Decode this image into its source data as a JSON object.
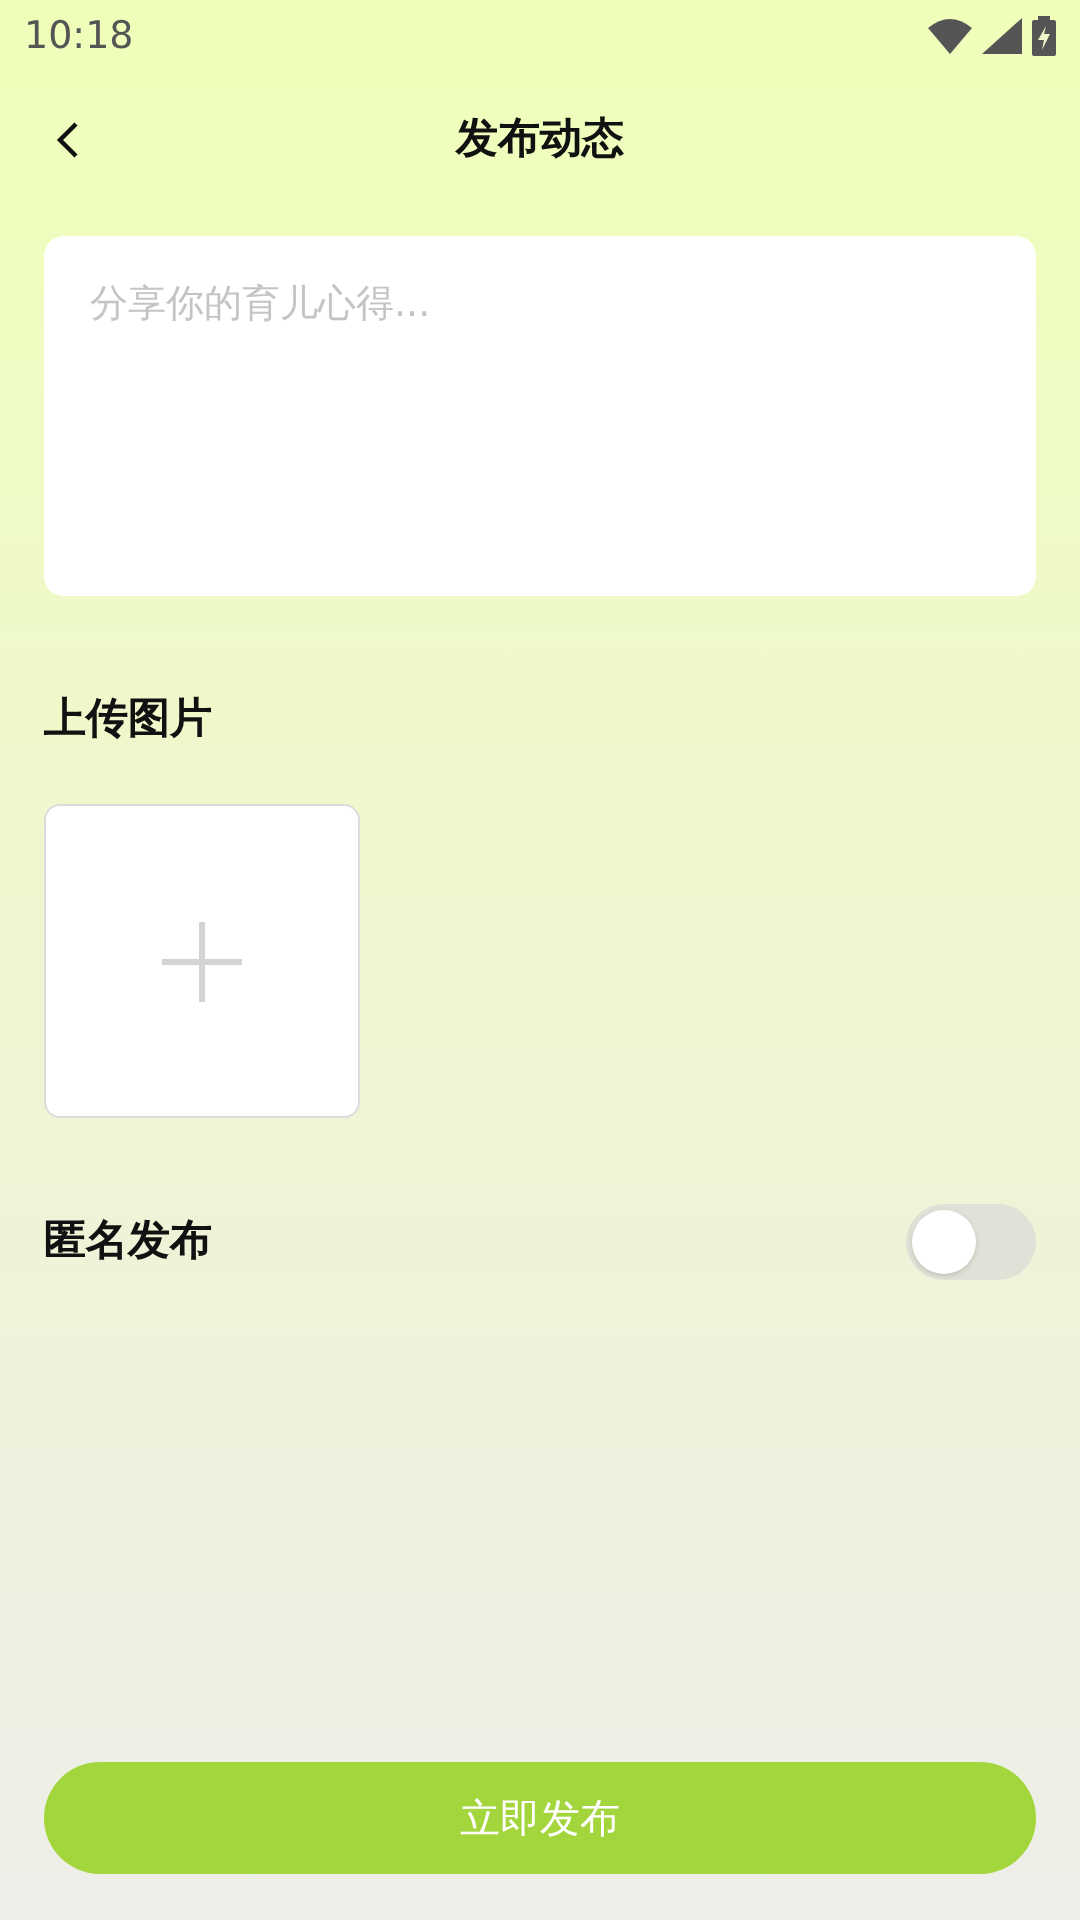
{
  "status_bar": {
    "time": "10:18"
  },
  "header": {
    "title": "发布动态"
  },
  "post_field": {
    "placeholder": "分享你的育儿心得..."
  },
  "upload": {
    "label": "上传图片"
  },
  "anonymous": {
    "label": "匿名发布",
    "on": false
  },
  "submit_button": {
    "label": "立即发布"
  }
}
